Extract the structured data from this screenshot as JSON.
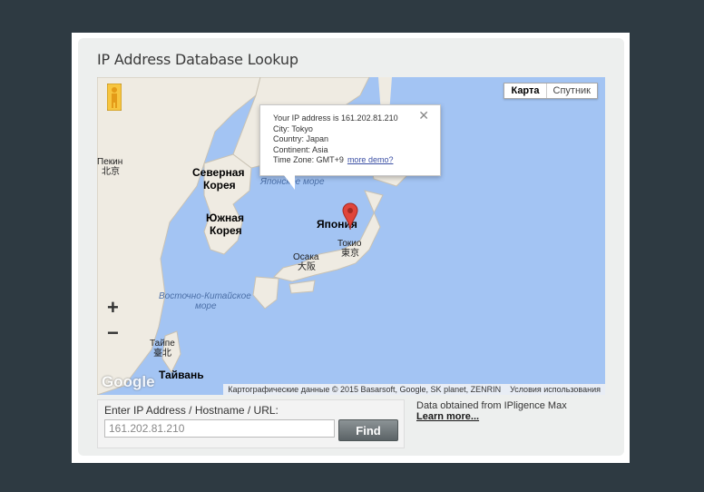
{
  "title": "IP Address Database Lookup",
  "map": {
    "type_buttons": [
      "Карта",
      "Спутник"
    ],
    "zoom_in": "+",
    "zoom_out": "−",
    "labels": {
      "north_korea_1": "Северная",
      "north_korea_2": "Корея",
      "south_korea_1": "Южная",
      "south_korea_2": "Корея",
      "japan": "Япония",
      "taiwan": "Тайвань",
      "sea_of_japan": "Японское море",
      "east_china_sea_1": "Восточно-Китайское",
      "east_china_sea_2": "море",
      "beijing_ru": "Пекин",
      "beijing_cn": "北京",
      "tokyo_ru": "Токио",
      "tokyo_jp": "東京",
      "osaka_ru": "Осака",
      "osaka_jp": "大阪",
      "taipei_ru": "Тайпе",
      "taipei_cn": "臺北"
    },
    "logo": "Google",
    "attribution": "Картографические данные © 2015 Basarsoft, Google, SK planet, ZENRIN",
    "terms": "Условия использования"
  },
  "info": {
    "ip_line": "Your IP address is 161.202.81.210",
    "city": "City: Tokyo",
    "country": "Country: Japan",
    "continent": "Continent: Asia",
    "timezone": "Time Zone: GMT+9",
    "more_demo": "more demo?",
    "close": "✕"
  },
  "lookup": {
    "label": "Enter IP Address / Hostname / URL:",
    "value": "161.202.81.210",
    "button": "Find"
  },
  "source": {
    "text": "Data obtained from IPligence Max",
    "link": "Learn more..."
  },
  "colors": {
    "water": "#a3c4f3",
    "land": "#efebe2",
    "pin": "#e0453a"
  }
}
